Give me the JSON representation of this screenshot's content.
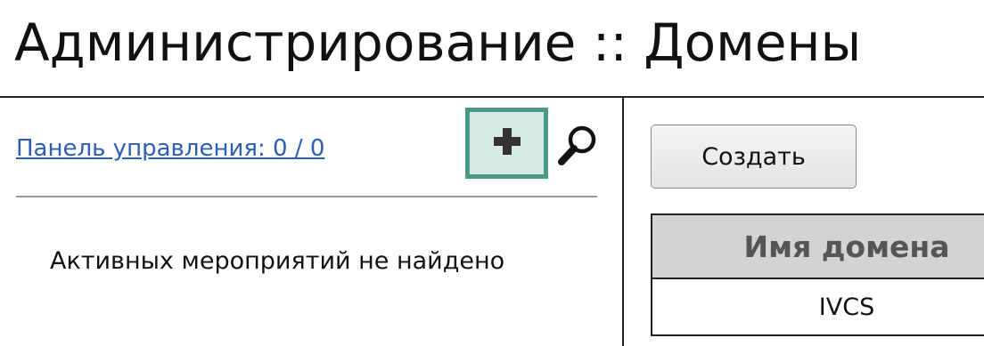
{
  "page": {
    "title": "Администрирование :: Домены"
  },
  "left_pane": {
    "dashboard_link": "Панель управления: 0 / 0",
    "add_icon": "plus-icon",
    "search_icon": "magnifier-icon",
    "empty_message": "Активных мероприятий не найдено"
  },
  "right_pane": {
    "create_label": "Создать",
    "table": {
      "header": "Имя домена",
      "rows": [
        "IVCS"
      ]
    }
  },
  "colors": {
    "add_button_border": "#4a9988",
    "add_button_bg": "#d7ebe3",
    "link": "#2c5fb3",
    "table_header_bg": "#d3d3d3"
  }
}
